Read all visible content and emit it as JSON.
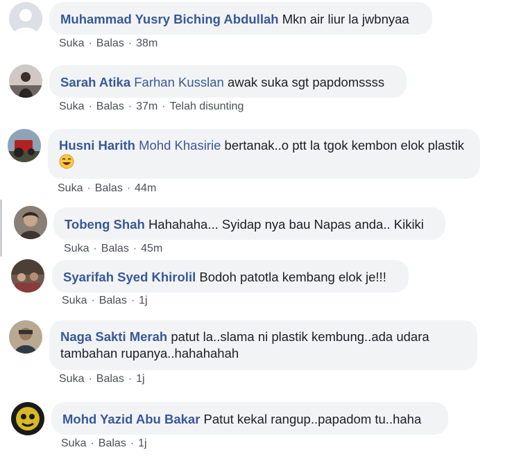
{
  "comments": [
    {
      "author": "Muhammad Yusry Biching Abdullah",
      "tag": "",
      "text": "Mkn air liur la jwbnyaa",
      "like": "Suka",
      "reply": "Balas",
      "time": "38m",
      "edited": ""
    },
    {
      "author": "Sarah Atika",
      "tag": "Farhan Kusslan",
      "text": "awak suka sgt papdomssss",
      "like": "Suka",
      "reply": "Balas",
      "time": "37m",
      "edited": "Telah disunting"
    },
    {
      "author": "Husni Harith",
      "tag": "Mohd Khasirie",
      "text": "bertanak..o ptt la tgok kembon elok plastik",
      "like": "Suka",
      "reply": "Balas",
      "time": "44m",
      "edited": ""
    },
    {
      "author": "Tobeng Shah",
      "tag": "",
      "text": "Hahahaha... Syidap nya bau Napas anda.. Kikiki",
      "like": "Suka",
      "reply": "Balas",
      "time": "45m",
      "edited": ""
    },
    {
      "author": "Syarifah Syed Khirolil",
      "tag": "",
      "text": "Bodoh patotla kembang elok je!!!",
      "like": "Suka",
      "reply": "Balas",
      "time": "1j",
      "edited": ""
    },
    {
      "author": "Naga Sakti Merah",
      "tag": "",
      "text": "patut la..slama ni plastik kembung..ada udara tambahan rupanya..hahahahah",
      "like": "Suka",
      "reply": "Balas",
      "time": "1j",
      "edited": ""
    },
    {
      "author": "Mohd Yazid Abu Bakar",
      "tag": "",
      "text": "Patut kekal rangup..papadom tu..haha",
      "like": "Suka",
      "reply": "Balas",
      "time": "1j",
      "edited": ""
    }
  ],
  "icons": {
    "emoji": "grinning-face-icon"
  }
}
